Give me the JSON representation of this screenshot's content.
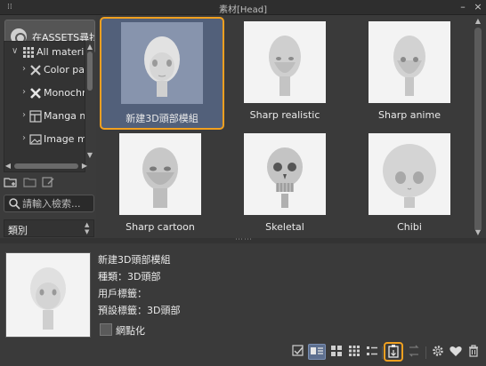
{
  "window": {
    "title": "素材[Head]",
    "minimize_label": "–",
    "close_label": "×",
    "grip_label": "⁞⁞"
  },
  "sidebar": {
    "assets_button": "在ASSETS尋找素",
    "tree": [
      {
        "label": "All materia",
        "arrow": "∨",
        "icon": "grid-icon"
      },
      {
        "label": "Color pa",
        "arrow": "›",
        "icon": "brush-icon"
      },
      {
        "label": "Monochr",
        "arrow": "›",
        "icon": "brush-icon"
      },
      {
        "label": "Manga m",
        "arrow": "›",
        "icon": "panel-icon"
      },
      {
        "label": "Image m",
        "arrow": "›",
        "icon": "image-icon"
      }
    ],
    "search_placeholder": "請輸入檢索...",
    "category_label": "類別"
  },
  "materials": [
    {
      "label": "新建3D頭部模組",
      "selected": true
    },
    {
      "label": "Sharp realistic",
      "selected": false
    },
    {
      "label": "Sharp anime",
      "selected": false
    },
    {
      "label": "Sharp cartoon",
      "selected": false
    },
    {
      "label": "Skeletal",
      "selected": false
    },
    {
      "label": "Chibi",
      "selected": false
    }
  ],
  "detail": {
    "name": "新建3D頭部模組",
    "type_line": "種類：3D頭部",
    "user_tags_line": "用戶標籤：",
    "default_tags_line": "預設標籤：3D頭部",
    "tile_label": "網點化"
  },
  "colors": {
    "accent": "#f0a020",
    "selected_bg": "#52607a"
  }
}
